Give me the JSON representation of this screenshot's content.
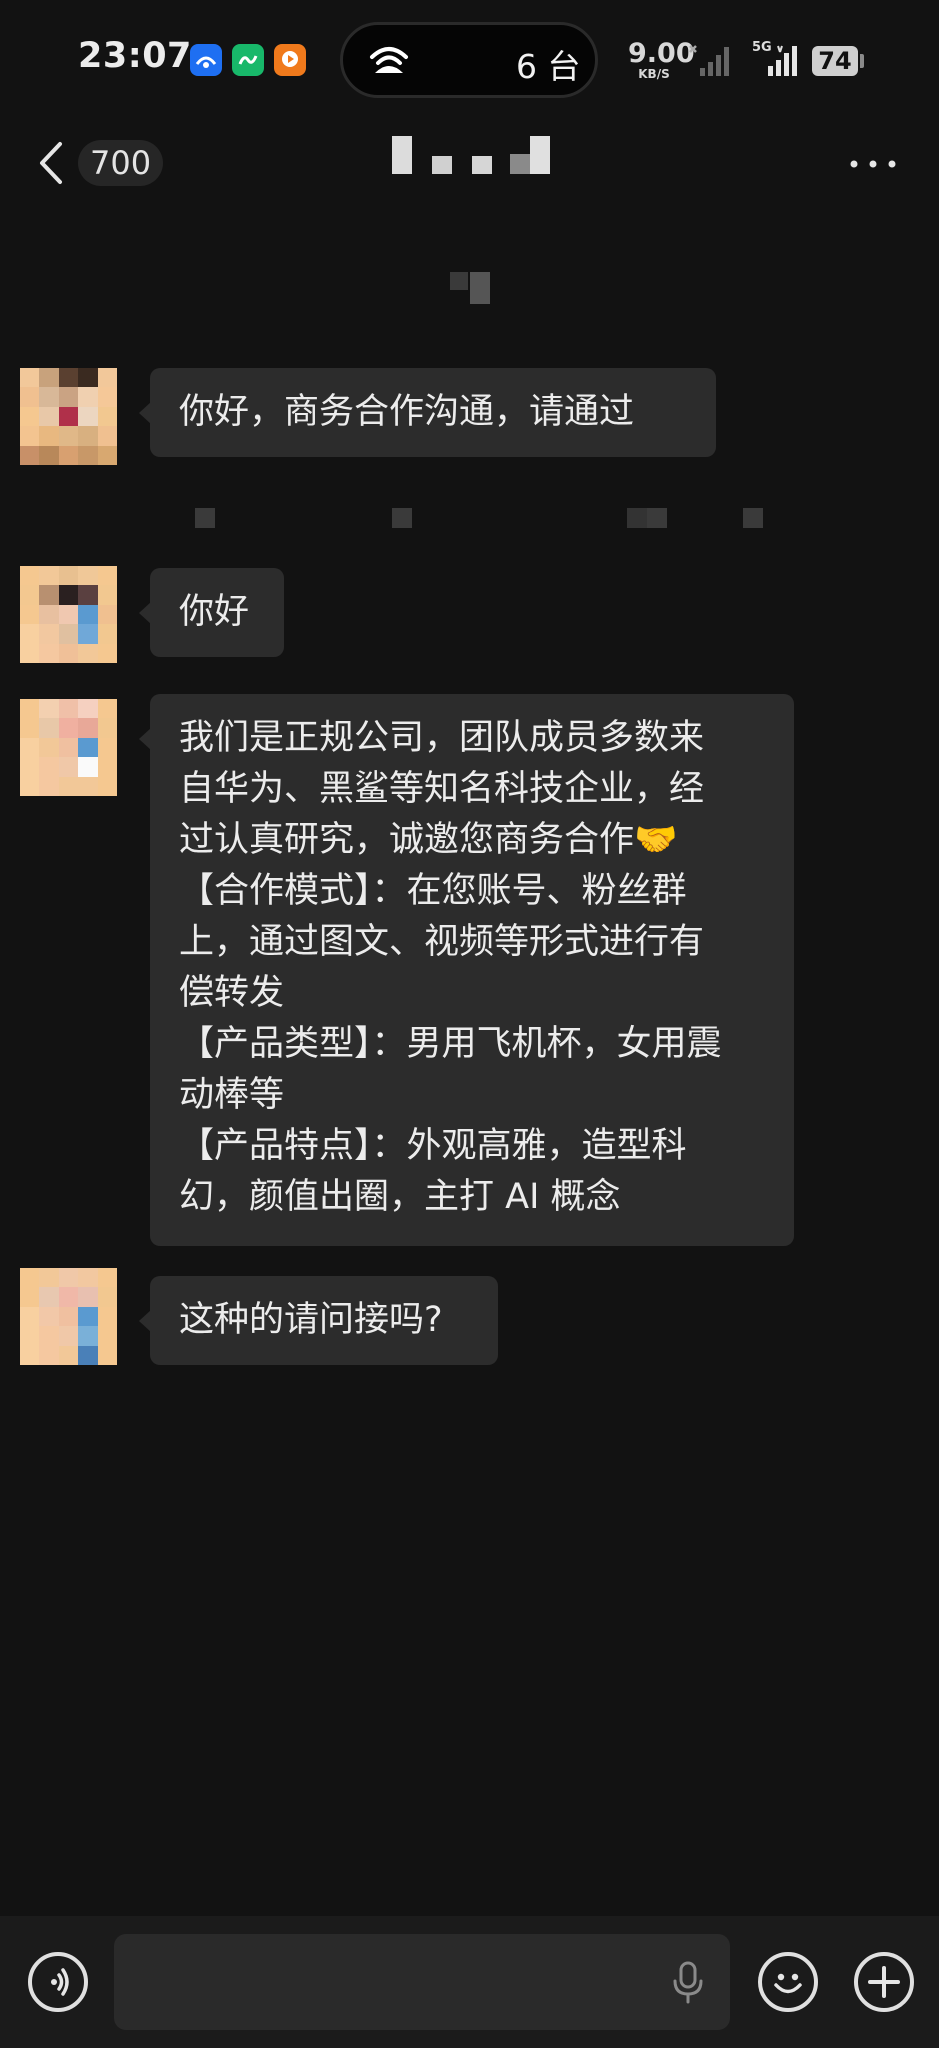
{
  "status_bar": {
    "time": "23:07",
    "hotspot_count": "6 台",
    "network_speed": "9.00",
    "network_unit": "KB/S",
    "signal_label": "5G",
    "battery": "74"
  },
  "header": {
    "unread_count": "700"
  },
  "messages": [
    {
      "lines": [
        "你好，商务合作沟通，请通过"
      ]
    },
    {
      "lines": [
        "你好"
      ]
    },
    {
      "lines": [
        "我们是正规公司，团队成员多数来",
        "自华为、黑鲨等知名科技企业，经",
        "过认真研究，诚邀您商务合作🤝",
        "【合作模式】：在您账号、粉丝群",
        "上，通过图文、视频等形式进行有",
        "偿转发",
        "【产品类型】：男用飞机杯，女用震",
        "动棒等",
        "【产品特点】：外观高雅，造型科",
        "幻，颜值出圈，主打 AI 概念"
      ]
    },
    {
      "lines": [
        "这种的请问接吗?"
      ]
    }
  ],
  "colors": {
    "background": "#121212",
    "bubble": "#2c2c2c",
    "text": "#ececec"
  },
  "icons": [
    "back-chevron-icon",
    "more-icon",
    "voice-icon",
    "microphone-icon",
    "emoji-icon",
    "plus-icon"
  ]
}
